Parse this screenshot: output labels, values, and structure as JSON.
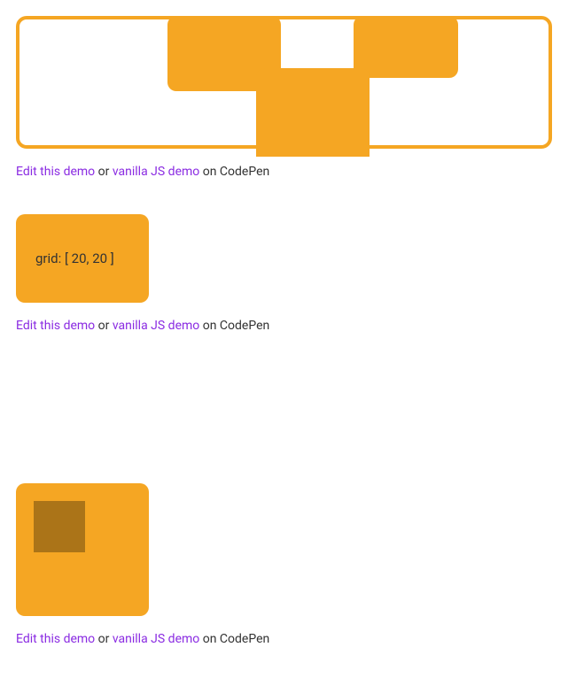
{
  "caption": {
    "edit_link": "Edit this demo",
    "or": " or ",
    "vanilla_link": "vanilla JS demo",
    "suffix": " on CodePen"
  },
  "demo2": {
    "grid_label": "grid: [ 20, 20 ]"
  }
}
